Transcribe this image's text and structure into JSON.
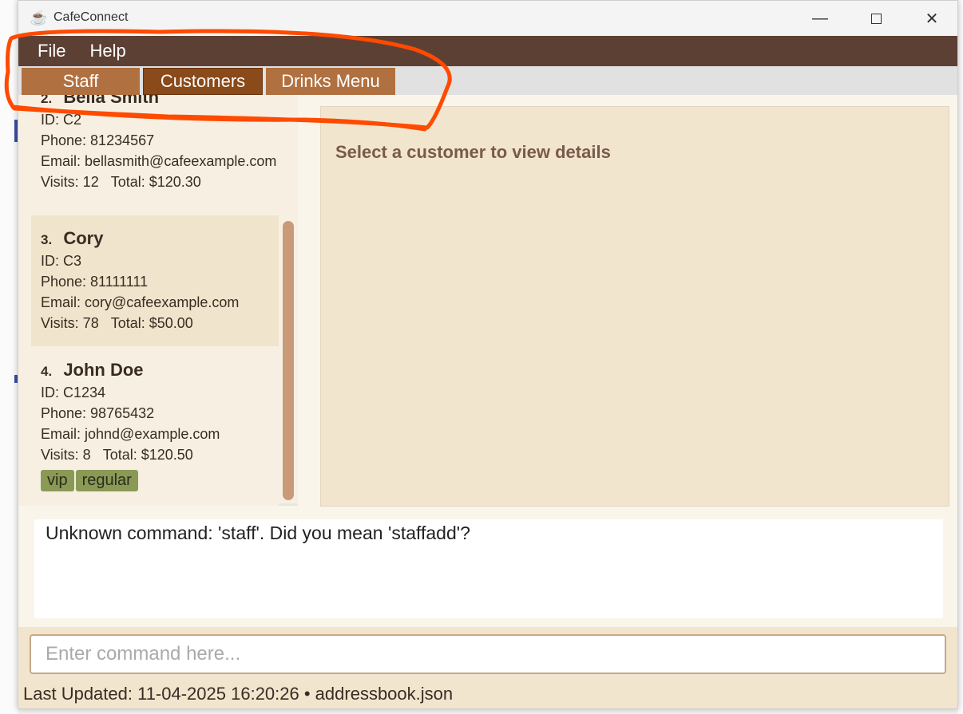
{
  "window": {
    "title": "CafeConnect",
    "icon": "coffee-cup-icon"
  },
  "menu": {
    "items": [
      {
        "label": "File"
      },
      {
        "label": "Help"
      }
    ]
  },
  "tabs": [
    {
      "label": "Staff",
      "active": false
    },
    {
      "label": "Customers",
      "active": true
    },
    {
      "label": "Drinks Menu",
      "active": false
    }
  ],
  "customers": [
    {
      "index": "2.",
      "name": "Bella Smith",
      "id": "ID: C2",
      "phone": "Phone: 81234567",
      "email": "Email: bellasmith@cafeexample.com",
      "visits": "Visits: 12",
      "total": "Total: $120.30",
      "tags": []
    },
    {
      "index": "3.",
      "name": "Cory",
      "id": "ID: C3",
      "phone": "Phone: 81111111",
      "email": "Email: cory@cafeexample.com",
      "visits": "Visits: 78",
      "total": "Total: $50.00",
      "tags": []
    },
    {
      "index": "4.",
      "name": "John Doe",
      "id": "ID: C1234",
      "phone": "Phone: 98765432",
      "email": "Email: johnd@example.com",
      "visits": "Visits: 8",
      "total": "Total: $120.50",
      "tags": [
        "vip",
        "regular"
      ]
    }
  ],
  "details": {
    "placeholder": "Select a customer to view details"
  },
  "result": {
    "text": "Unknown command: 'staff'. Did you mean 'staffadd'?"
  },
  "command": {
    "placeholder": "Enter command here...",
    "value": ""
  },
  "status": {
    "text": "Last Updated: 11-04-2025 16:20:26 • addressbook.json"
  },
  "colors": {
    "menu_bar": "#5d4034",
    "tab": "#b07040",
    "tab_active": "#8a4a1a",
    "tag": "#8a9a56",
    "annotation": "#ff4a00"
  }
}
